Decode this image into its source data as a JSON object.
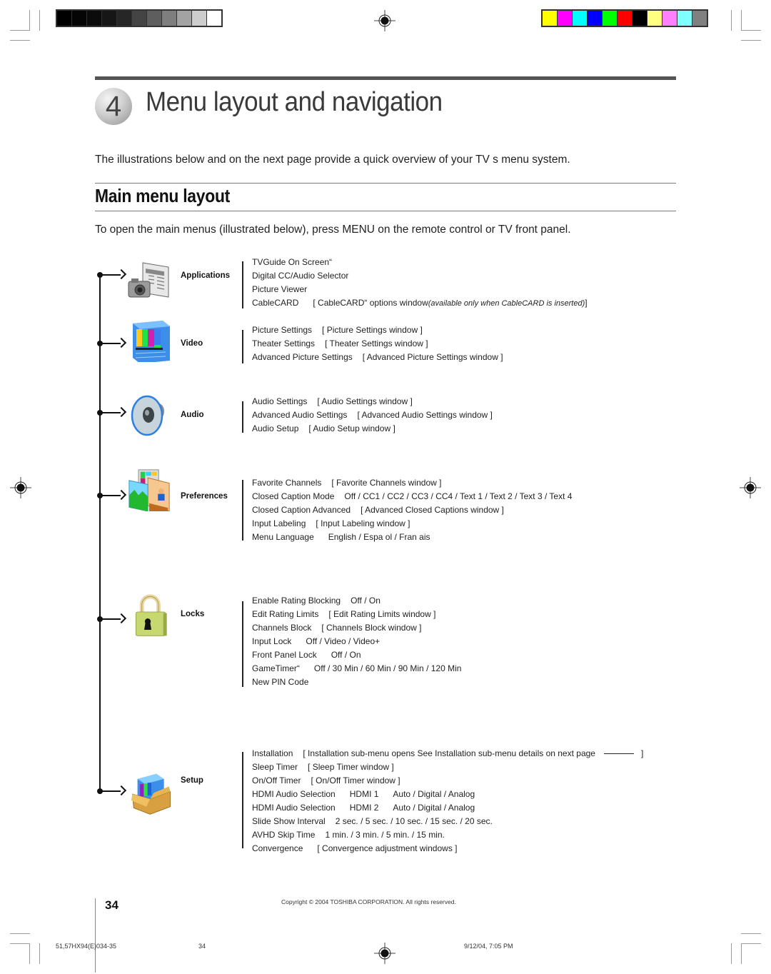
{
  "print_marks": {
    "grayscale_swatches": [
      "#000000",
      "#050505",
      "#0b0b0b",
      "#161616",
      "#262626",
      "#444444",
      "#5e5e5e",
      "#7e7e7e",
      "#a3a3a3",
      "#cdcdcd",
      "#ffffff"
    ],
    "color_swatches": [
      "#ffff00",
      "#ff00ff",
      "#00ffff",
      "#0000ff",
      "#00ff00",
      "#ff0000",
      "#000000",
      "#ffff80",
      "#ff80ff",
      "#80ffff",
      "#808080"
    ]
  },
  "header": {
    "chapter_number": "4",
    "chapter_title": "Menu layout and navigation",
    "intro": "The illustrations below and on the next page provide a quick overview of your TV s menu system."
  },
  "section": {
    "title": "Main menu layout",
    "instruction": "To open the main menus (illustrated below), press MENU on the remote control or TV front panel."
  },
  "menus": {
    "applications": {
      "label": "Applications",
      "icon": "guide-camera-icon",
      "items": [
        {
          "name": "TVGuide On Screen“"
        },
        {
          "name": "Digital CC/Audio Selector"
        },
        {
          "name": "Picture Viewer"
        },
        {
          "name": "CableCARD",
          "value": "[ CableCARD“ options  window",
          "note": "(available only when CableCARD is inserted)",
          "tail": " ]"
        }
      ]
    },
    "video": {
      "label": "Video",
      "icon": "tv-icon",
      "items": [
        {
          "name": "Picture Settings",
          "value": "[ Picture Settings window ]"
        },
        {
          "name": "Theater Settings",
          "value": "[ Theater Settings window ]"
        },
        {
          "name": "Advanced Picture Settings",
          "value": "[ Advanced Picture Settings window ]"
        }
      ]
    },
    "audio": {
      "label": "Audio",
      "icon": "speaker-icon",
      "items": [
        {
          "name": "Audio Settings",
          "value": "[ Audio Settings window ]"
        },
        {
          "name": "Advanced Audio Settings",
          "value": "[ Advanced Audio Settings window ]"
        },
        {
          "name": "Audio Setup",
          "value": "[ Audio Setup window ]"
        }
      ]
    },
    "preferences": {
      "label": "Preferences",
      "icon": "pictures-icon",
      "items": [
        {
          "name": "Favorite Channels",
          "value": "[ Favorite Channels window ]"
        },
        {
          "name": "Closed Caption Mode",
          "value": "Off / CC1 / CC2 / CC3 / CC4 / Text 1 / Text 2 / Text 3 / Text 4"
        },
        {
          "name": "Closed Caption Advanced",
          "value": "[ Advanced Closed Captions window ]"
        },
        {
          "name": "Input Labeling",
          "value": "[ Input Labeling window ]"
        },
        {
          "name": "Menu Language",
          "value": "English / Espa ol / Fran ais"
        }
      ]
    },
    "locks": {
      "label": "Locks",
      "icon": "padlock-icon",
      "items": [
        {
          "name": "Enable Rating Blocking",
          "value": "Off / On"
        },
        {
          "name": "Edit Rating Limits",
          "value": "[ Edit Rating Limits window ]"
        },
        {
          "name": "Channels Block",
          "value": "[ Channels Block window ]"
        },
        {
          "name": "Input Lock",
          "value": "Off / Video / Video+"
        },
        {
          "name": "Front Panel Lock",
          "value": "Off / On"
        },
        {
          "name": "GameTimer“",
          "value": "Off / 30 Min / 60 Min / 90 Min / 120 Min"
        },
        {
          "name": "New PIN Code"
        }
      ]
    },
    "setup": {
      "label": "Setup",
      "icon": "box-icon",
      "items": [
        {
          "name": "Installation",
          "value": "[ Installation sub-menu opens   See Installation sub-menu details on next page",
          "tail": "]"
        },
        {
          "name": "Sleep Timer",
          "value": "[ Sleep Timer window ]"
        },
        {
          "name": "On/Off Timer",
          "value": "[ On/Off Timer window ]"
        },
        {
          "name": "HDMI Audio Selection",
          "sub": "HDMI 1",
          "value": "Auto / Digital / Analog"
        },
        {
          "name": "HDMI Audio Selection",
          "sub": "HDMI 2",
          "value": "Auto / Digital / Analog"
        },
        {
          "name": "Slide Show Interval",
          "value": "2 sec. / 5 sec. / 10 sec. / 15 sec. / 20 sec."
        },
        {
          "name": "AVHD Skip Time",
          "value": "1 min. / 3 min. / 5 min. / 15 min."
        },
        {
          "name": "Convergence",
          "value": "[ Convergence adjustment windows ]"
        }
      ]
    }
  },
  "footer": {
    "page_number": "34",
    "copyright": "Copyright © 2004 TOSHIBA CORPORATION. All rights reserved.",
    "slug_file": "51,57HX94(E)034-35",
    "slug_page": "34",
    "slug_date": "9/12/04, 7:05 PM"
  }
}
